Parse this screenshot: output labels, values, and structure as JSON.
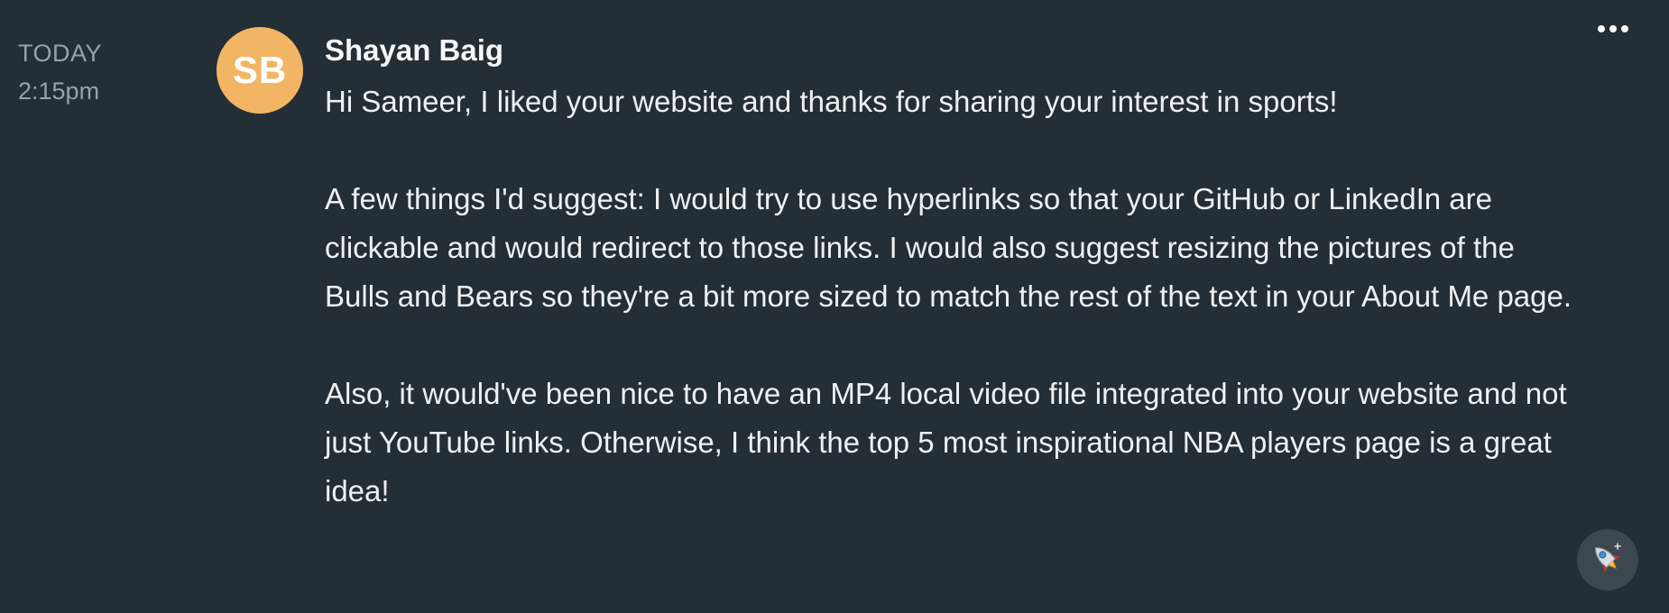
{
  "timestamp": {
    "day": "TODAY",
    "time": "2:15pm"
  },
  "author": {
    "initials": "SB",
    "name": "Shayan Baig",
    "avatar_color": "#f2b564"
  },
  "message": {
    "paragraphs": [
      "Hi Sameer, I liked your website and thanks for sharing your interest in sports!",
      "A few things I'd suggest: I would try to use hyperlinks so that your GitHub or LinkedIn are clickable and would redirect to those links. I would also suggest resizing the pictures of the Bulls and Bears so they're a bit more sized to match the rest of the text in your About Me page.",
      "Also, it would've been nice to have an MP4 local video file integrated into your website and not just YouTube links. Otherwise, I think the top 5 most inspirational NBA players page is a great idea!"
    ]
  },
  "actions": {
    "more_icon": "more-horizontal-icon",
    "boost_icon": "rocket-icon"
  },
  "colors": {
    "background": "#242e36",
    "muted_text": "#93a2b0",
    "text": "#eef1f4",
    "boost_button_bg": "#3d4750"
  }
}
